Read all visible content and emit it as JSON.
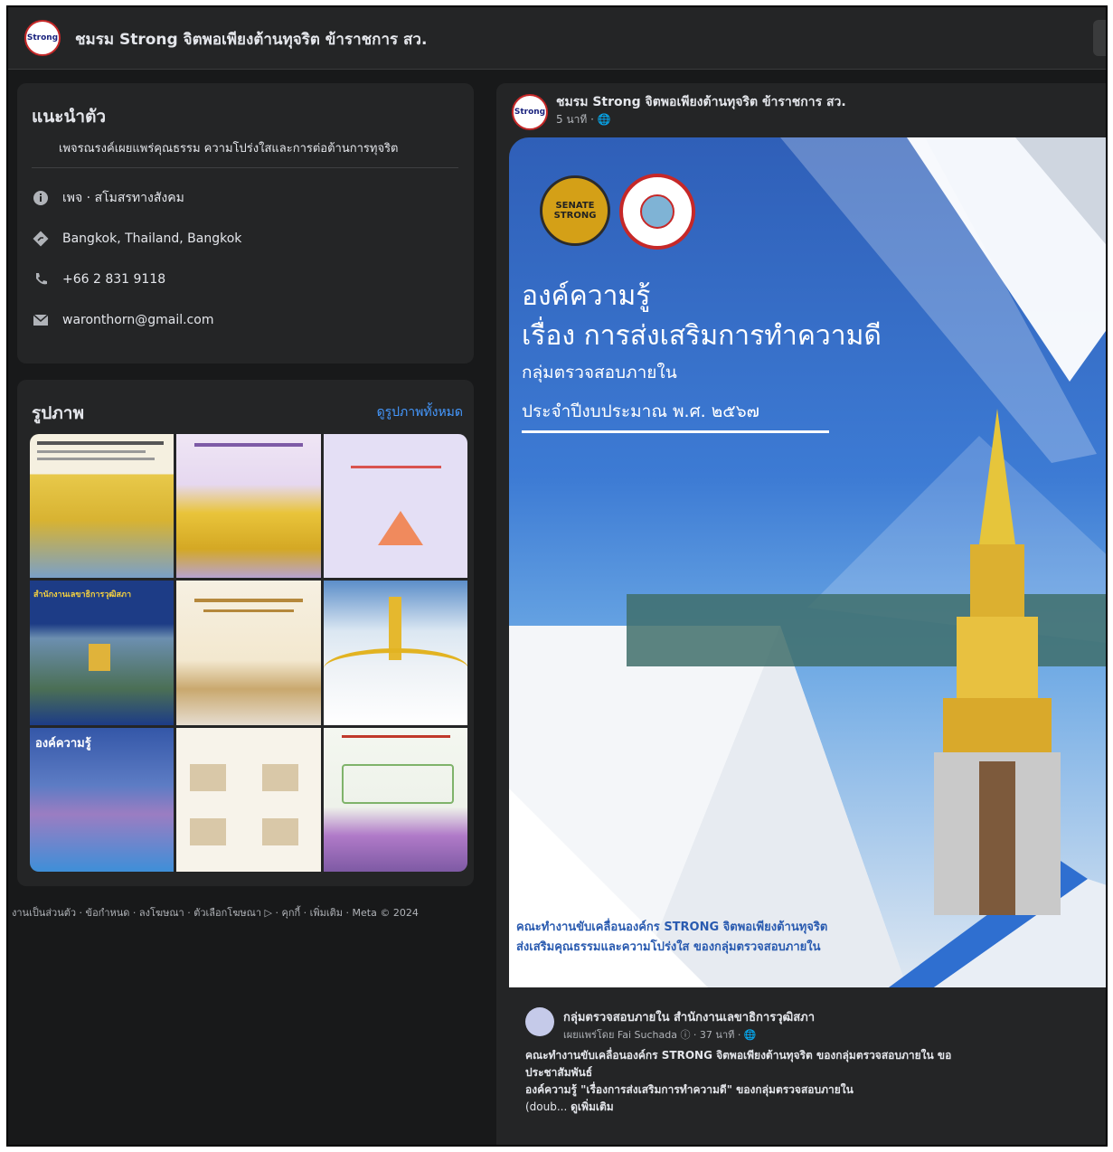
{
  "header": {
    "avatar_text": "Strong",
    "title": "ชมรม Strong จิตพอเพียงต้านทุจริต ข้าราชการ สว."
  },
  "intro": {
    "heading": "แนะนำตัว",
    "description": "เพจรณรงค์เผยแพร่คุณธรรม ความโปร่งใสและการต่อต้านการทุจริต",
    "category": "เพจ · สโมสรทางสังคม",
    "location": "Bangkok, Thailand, Bangkok",
    "phone": "+66 2 831 9118",
    "email": "waronthorn@gmail.com"
  },
  "photos": {
    "heading": "รูปภาพ",
    "see_all": "ดูรูปภาพทั้งหมด",
    "tile_texts": [
      "",
      "",
      "",
      "สำนักงานเลขาธิการวุฒิสภา",
      "",
      "",
      "องค์ความรู้",
      "",
      ""
    ]
  },
  "footer": {
    "text": "งานเป็นส่วนตัว · ข้อกำหนด · ลงโฆษณา · ตัวเลือกโฆษณา ▷ · คุกกี้ · เพิ่มเติม · Meta © 2024"
  },
  "post": {
    "author": "ชมรม Strong จิตพอเพียงต้านทุจริต ข้าราชการ สว.",
    "time": "5 นาที · 🌐",
    "image": {
      "title_line1": "องค์ความรู้",
      "title_line2": "เรื่อง การส่งเสริมการทำความดี",
      "subtitle": "กลุ่มตรวจสอบภายใน",
      "year": "ประจำปีงบประมาณ พ.ศ. ๒๕๖๗",
      "logo1": "SENATE STRONG",
      "footer_line1": "คณะทำงานขับเคลื่อนองค์กร STRONG จิตพอเพียงต้านทุจริต",
      "footer_line2": "ส่งเสริมคุณธรรมและความโปร่งใส ของกลุ่มตรวจสอบภายใน"
    },
    "shared": {
      "name": "กลุ่มตรวจสอบภายใน สำนักงานเลขาธิการวุฒิสภา",
      "meta": "เผยแพร่โดย Fai Suchada ⓘ · 37 นาที · 🌐",
      "line1": "คณะทำงานขับเคลื่อนองค์กร STRONG จิตพอเพียงต้านทุจริต ของกลุ่มตรวจสอบภายใน ขอ",
      "line2": "ประชาสัมพันธ์",
      "line3": "องค์ความรู้ \"เรื่องการส่งเสริมการทำความดี\" ของกลุ่มตรวจสอบภายใน",
      "line4_prefix": "(doub...",
      "see_more": "ดูเพิ่มเติม"
    }
  }
}
